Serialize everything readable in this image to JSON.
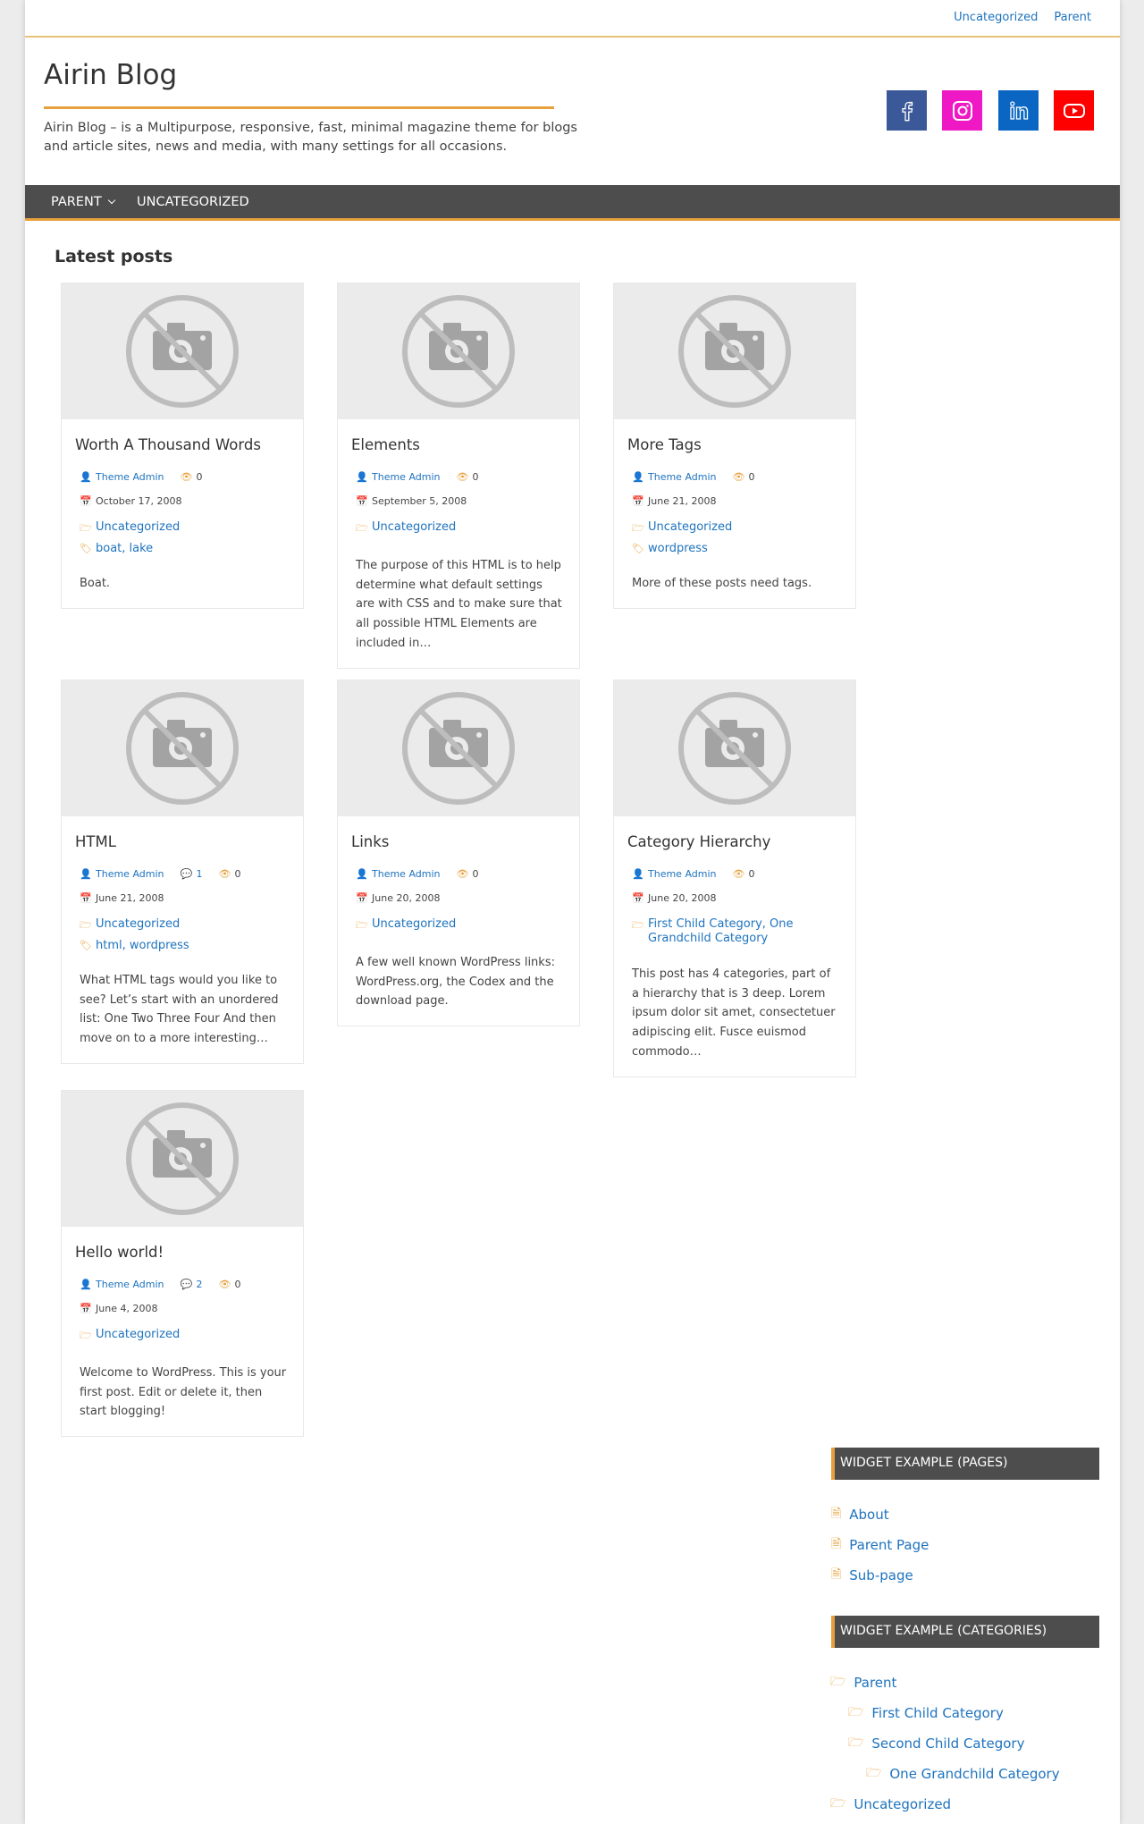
{
  "topbar": {
    "links": [
      "Uncategorized",
      "Parent"
    ]
  },
  "header": {
    "title": "Airin Blog",
    "tagline": "Airin Blog – is a Multipurpose, responsive, fast, minimal magazine theme for blogs and article sites, news and media, with many settings for all occasions."
  },
  "social": {
    "facebook_color": "#3b5998",
    "instagram_color": "#ee19c4",
    "linkedin_color": "#0a66c2",
    "youtube_color": "#ff0000"
  },
  "nav": {
    "items": [
      "PARENT",
      "UNCATEGORIZED"
    ]
  },
  "main": {
    "section_title": "Latest posts"
  },
  "posts": [
    {
      "title": "Worth A Thousand Words",
      "author": "Theme Admin",
      "comments": null,
      "views": "0",
      "date": "October 17, 2008",
      "categories": "Uncategorized",
      "tags": "boat, lake",
      "excerpt": "Boat."
    },
    {
      "title": "Elements",
      "author": "Theme Admin",
      "comments": null,
      "views": "0",
      "date": "September 5, 2008",
      "categories": "Uncategorized",
      "tags": null,
      "excerpt": "The purpose of this HTML is to help determine what default settings are with CSS and to make sure that all possible HTML Elements are included in…"
    },
    {
      "title": "More Tags",
      "author": "Theme Admin",
      "comments": null,
      "views": "0",
      "date": "June 21, 2008",
      "categories": "Uncategorized",
      "tags": "wordpress",
      "excerpt": "More of these posts need tags."
    },
    {
      "title": "HTML",
      "author": "Theme Admin",
      "comments": "1",
      "views": "0",
      "date": "June 21, 2008",
      "categories": "Uncategorized",
      "tags": "html, wordpress",
      "excerpt": "What HTML tags would you like to see? Let’s start with an unordered list: One Two Three Four And then move on to a more interesting…"
    },
    {
      "title": "Links",
      "author": "Theme Admin",
      "comments": null,
      "views": "0",
      "date": "June 20, 2008",
      "categories": "Uncategorized",
      "tags": null,
      "excerpt": "A few well known WordPress links: WordPress.org, the Codex and the download page."
    },
    {
      "title": "Category Hierarchy",
      "author": "Theme Admin",
      "comments": null,
      "views": "0",
      "date": "June 20, 2008",
      "categories": "First Child Category, One Grandchild Category",
      "tags": null,
      "excerpt": "This post has 4 categories, part of a hierarchy that is 3 deep. Lorem ipsum dolor sit amet, consectetuer adipiscing elit. Fusce euismod commodo…"
    },
    {
      "title": "Hello world!",
      "author": "Theme Admin",
      "comments": "2",
      "views": "0",
      "date": "June 4, 2008",
      "categories": "Uncategorized",
      "tags": null,
      "excerpt": "Welcome to WordPress. This is your first post. Edit or delete it, then start blogging!"
    }
  ],
  "widgets": {
    "pages": {
      "title": "WIDGET EXAMPLE (PAGES)",
      "items": [
        "About",
        "Parent Page",
        "Sub-page"
      ]
    },
    "categories": {
      "title": "WIDGET EXAMPLE (CATEGORIES)",
      "items": [
        "Parent",
        "First Child Category",
        "Second Child Category",
        "One Grandchild Category",
        "Uncategorized"
      ]
    }
  },
  "colors": {
    "accent": "#e8a03c",
    "link": "#1e73be",
    "nav_bg": "#4d4d4d"
  }
}
